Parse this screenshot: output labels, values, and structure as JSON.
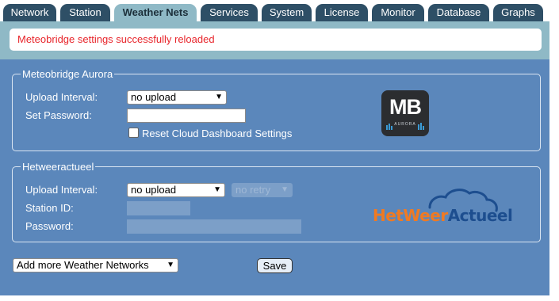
{
  "tabs": [
    {
      "label": "Network",
      "active": false
    },
    {
      "label": "Station",
      "active": false
    },
    {
      "label": "Weather Nets",
      "active": true
    },
    {
      "label": "Services",
      "active": false
    },
    {
      "label": "System",
      "active": false
    },
    {
      "label": "License",
      "active": false
    },
    {
      "label": "Monitor",
      "active": false
    },
    {
      "label": "Database",
      "active": false
    },
    {
      "label": "Graphs",
      "active": false
    }
  ],
  "message": "Meteobridge settings successfully reloaded",
  "aurora": {
    "legend": "Meteobridge Aurora",
    "upload_interval_label": "Upload Interval:",
    "upload_interval_value": "no upload",
    "password_label": "Set Password:",
    "password_value": "",
    "reset_label": "Reset Cloud Dashboard Settings",
    "reset_checked": false,
    "logo_text": "MB",
    "logo_subtext": "AURORA"
  },
  "hetweeractueel": {
    "legend": "Hetweeractueel",
    "upload_interval_label": "Upload Interval:",
    "upload_interval_value": "no upload",
    "retry_value": "no retry",
    "station_id_label": "Station ID:",
    "password_label": "Password:",
    "logo_text_part1": "HetWeer",
    "logo_text_part2": "Actueel"
  },
  "footer": {
    "add_networks_value": "Add more Weather Networks",
    "save_label": "Save"
  },
  "colors": {
    "tab": "#2e4f66",
    "tab_active": "#8fb9c6",
    "panel": "#5b87bb",
    "message_text": "#e8252b",
    "logo_orange": "#f07a22",
    "logo_blue": "#1d4e8f"
  }
}
